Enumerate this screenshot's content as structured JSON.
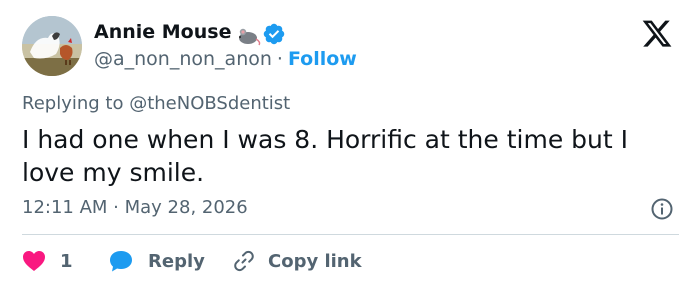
{
  "author": {
    "display_name": "Annie Mouse",
    "handle": "@a_non_non_anon",
    "separator": "·",
    "follow_label": "Follow",
    "avatar_icon": "avatar-photo-chicken-field",
    "emoji_icon": "mouse-icon",
    "verified_icon": "verified-badge-icon",
    "verified_color": "#1d9bf0"
  },
  "header": {
    "logo_icon": "x-logo-icon"
  },
  "tweet": {
    "replying_to": "Replying to @theNOBSdentist",
    "text": "I had one when I was 8. Horrific at the time but I love my smile.",
    "timestamp": "12:11 AM · May 28, 2026",
    "info_icon": "info-icon"
  },
  "actions": {
    "like_count": "1",
    "like_icon": "heart-icon",
    "like_color": "#f91880",
    "reply_label": "Reply",
    "reply_icon": "speech-bubble-icon",
    "reply_icon_color": "#1d9bf0",
    "copy_label": "Copy link",
    "copy_icon": "link-icon"
  },
  "colors": {
    "text_primary": "#0f1419",
    "text_secondary": "#536471",
    "accent": "#1d9bf0",
    "divider": "#cfd9de"
  }
}
